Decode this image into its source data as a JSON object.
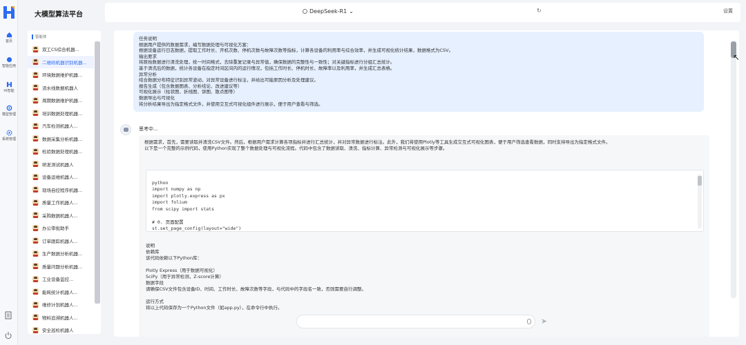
{
  "app": {
    "brand": "大模型算法平台"
  },
  "rail": [
    {
      "label": "首页",
      "icon": "home-icon"
    },
    {
      "label": "智能应用",
      "icon": "apps-icon"
    },
    {
      "label": "Hi智能",
      "icon": "logo-small-icon"
    },
    {
      "label": "模型管理",
      "icon": "model-icon"
    },
    {
      "label": "系统管理",
      "icon": "settings-icon"
    }
  ],
  "header": {
    "model": "DeepSeek-R1",
    "settings": "设置"
  },
  "sidebar": {
    "header": "智能体",
    "items": [
      {
        "label": "双工CS综合机器..."
      },
      {
        "label": "二维码机器识别机器..."
      },
      {
        "label": "环境数据维护机器..."
      },
      {
        "label": "流水线数据机器人"
      },
      {
        "label": "周期数据维护机器..."
      },
      {
        "label": "培训数据处理机器..."
      },
      {
        "label": "汽车检测机器人..."
      },
      {
        "label": "数据采集分析机器..."
      },
      {
        "label": "检验数据处理机器..."
      },
      {
        "label": "研发测试机器人"
      },
      {
        "label": "设备运维机器人..."
      },
      {
        "label": "现场自控程序机器..."
      },
      {
        "label": "质量工作机器人..."
      },
      {
        "label": "采购数据机器人..."
      },
      {
        "label": "办公审批助手"
      },
      {
        "label": "订单跟踪机器人..."
      },
      {
        "label": "生产数据分析机器..."
      },
      {
        "label": "质量问题分析机器..."
      },
      {
        "label": "工业设备监控..."
      },
      {
        "label": "能耗统计机器人..."
      },
      {
        "label": "维修计划机器人..."
      },
      {
        "label": "物料追溯机器人..."
      },
      {
        "label": "安全巡检机器人"
      }
    ]
  },
  "chat": {
    "user_lines": [
      "任务说明",
      "根据用户提供的数据需求，编写数据处理与可视化方案：",
      "根据设备运行日志数据，提取工作时长、开机次数、停机次数与故障次数等指标，计算各设备的利用率与综合效率，并生成可视化统计结果，数据格式为CSV。",
      "输出要求",
      "将原始数据进行清洗处理，统一时间格式，去除重复记录与异常值，确保数据的完整性与一致性；对关键指标进行分组汇总统计。",
      "基于清洗后的数据，统计各设备在指定时间区间内的运行情况，包括工作时长、停机时长、故障率以及利用率，并生成汇总表格。",
      "异常分析",
      "结合数据分布特征识别异常波动，对异常设备进行标注，并给出可能原因分析及处理建议。",
      "报告生成（包含数据图表、分析结论、改进建议等）",
      "可视化展示（柱状图、折线图、饼图、散点图等）",
      "数据导出与可视化",
      "将分析结果导出为指定格式文件，并使用交互式可视化组件进行展示，便于用户查看与筛选。"
    ],
    "thinking": "思考中...",
    "answer_intro": [
      "根据需求，首先，需要读取并清洗CSV文件。然后，根据用户需求计算各项指标并进行汇总统计，并对异常数据进行标注。此外，我们将使用Plotly等工具生成交互式可视化图表，便于用户筛选查看数据，同时支持导出为指定格式文件。",
      "以下是一个完整的示例代码，使用Python实现了整个数据处理与可视化流程。代码中包含了数据读取、清洗、指标计算、异常检测与可视化展示等步骤。"
    ],
    "code_lines": [
      "",
      "python",
      "import numpy as np",
      "import plotly.express as px",
      "import folium",
      "from scipy import stats",
      "",
      "# 0. 页面配置",
      "st.set_page_config(layout=\"wide\")"
    ],
    "note_lines": [
      "说明",
      "依赖库",
      "该代码依赖以下Python库：",
      "",
      "Plotly Express（用于数据可视化）",
      "SciPy（用于异常检测，Z-score计算）",
      "数据字段",
      "请确保CSV文件包含设备ID、时间、工作时长、故障次数等字段，与代码中的字段名一致，否则需要自行调整。",
      "",
      "运行方式",
      "将以上代码保存为一个Python文件（如app.py），在命令行中执行。"
    ]
  }
}
